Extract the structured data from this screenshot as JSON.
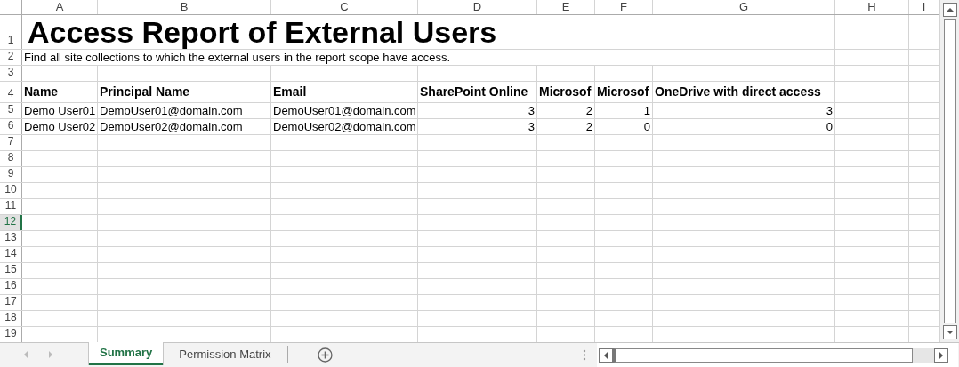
{
  "columns": [
    "A",
    "B",
    "C",
    "D",
    "E",
    "F",
    "G",
    "H",
    "I"
  ],
  "row_headers": [
    {
      "label": "1",
      "selected": false
    },
    {
      "label": "2",
      "selected": false
    },
    {
      "label": "3",
      "selected": false
    },
    {
      "label": "4",
      "selected": false
    },
    {
      "label": "5",
      "selected": false
    },
    {
      "label": "6",
      "selected": false
    },
    {
      "label": "7",
      "selected": false
    },
    {
      "label": "8",
      "selected": false
    },
    {
      "label": "9",
      "selected": false
    },
    {
      "label": "10",
      "selected": false
    },
    {
      "label": "11",
      "selected": false
    },
    {
      "label": "12",
      "selected": true
    },
    {
      "label": "13",
      "selected": false
    },
    {
      "label": "14",
      "selected": false
    },
    {
      "label": "15",
      "selected": false
    },
    {
      "label": "16",
      "selected": false
    },
    {
      "label": "17",
      "selected": false
    },
    {
      "label": "18",
      "selected": false
    },
    {
      "label": "19",
      "selected": false
    }
  ],
  "title": "Access Report of External Users",
  "subtitle": "Find all site collections to which the external users in the report scope have access.",
  "table": {
    "headers": [
      "Name",
      "Principal Name",
      "Email",
      "SharePoint Online",
      "Microsof",
      "Microsof",
      "OneDrive with direct access"
    ],
    "rows": [
      [
        "Demo User01",
        "DemoUser01@domain.com",
        "DemoUser01@domain.com",
        "3",
        "2",
        "1",
        "3"
      ],
      [
        "Demo User02",
        "DemoUser02@domain.com",
        "DemoUser02@domain.com",
        "3",
        "2",
        "0",
        "0"
      ]
    ]
  },
  "sheet_tabs": [
    {
      "label": "Summary",
      "selected": true
    },
    {
      "label": "Permission Matrix",
      "selected": false
    }
  ]
}
